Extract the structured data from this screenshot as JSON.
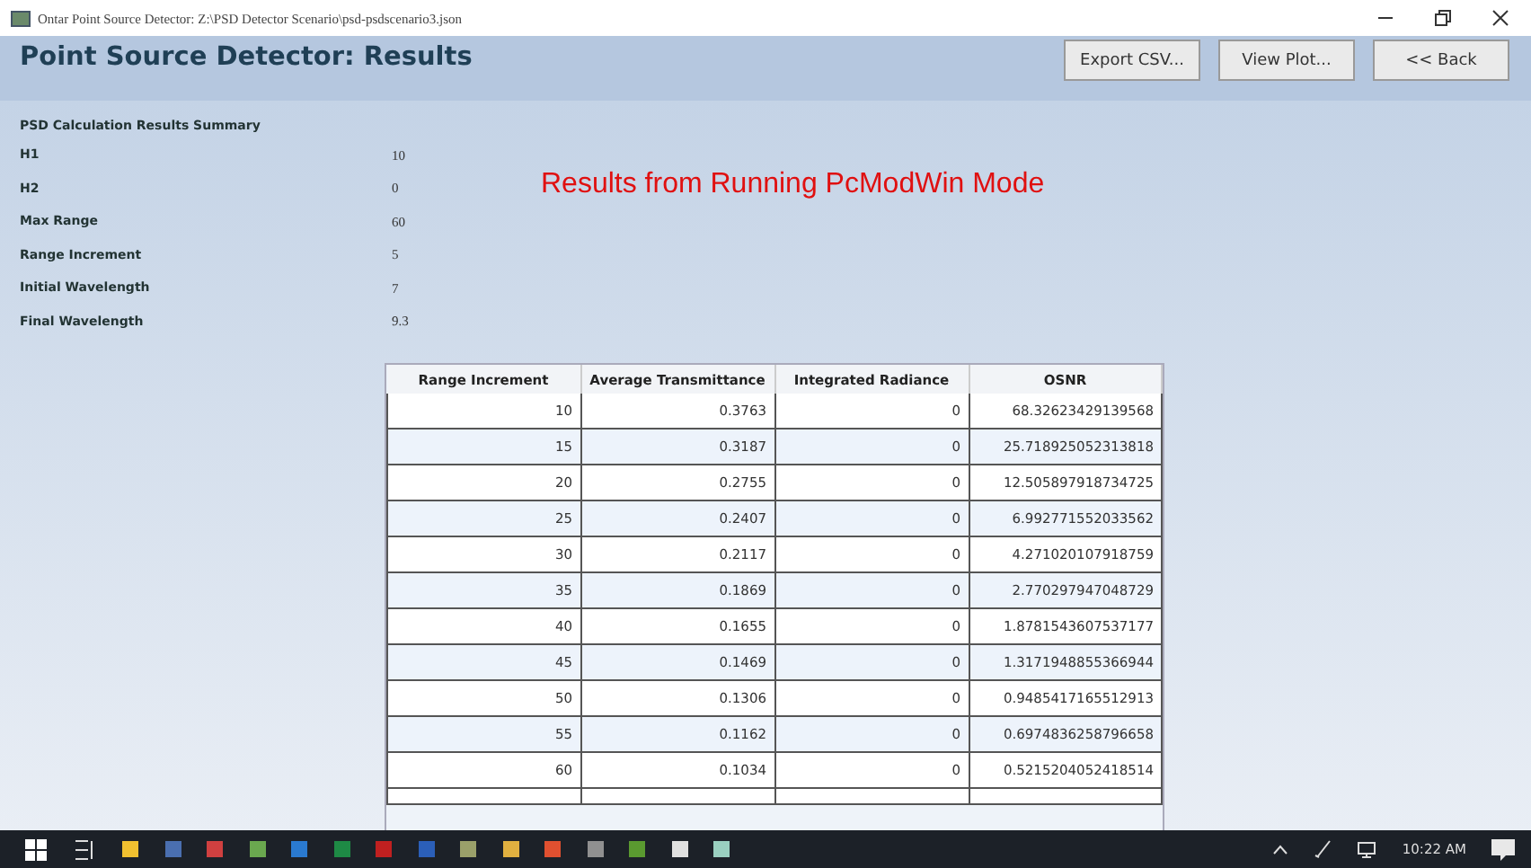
{
  "window": {
    "title": "Ontar Point Source Detector: Z:\\PSD Detector  Scenario\\psd-psdscenario3.json"
  },
  "header": {
    "title": "Point Source Detector: Results",
    "buttons": [
      "Export CSV...",
      "View Plot...",
      "<< Back"
    ]
  },
  "summary": {
    "heading": "PSD Calculation Results Summary",
    "items": [
      {
        "label": "H1",
        "value": "10"
      },
      {
        "label": "H2",
        "value": "0"
      },
      {
        "label": "Max Range",
        "value": "60"
      },
      {
        "label": "Range Increment",
        "value": "5"
      },
      {
        "label": "Initial Wavelength",
        "value": "7"
      },
      {
        "label": "Final Wavelength",
        "value": "9.3"
      }
    ]
  },
  "mode_message": "Results from Running PcModWin Mode",
  "table": {
    "columns": [
      "Range Increment",
      "Average Transmittance",
      "Integrated Radiance",
      "OSNR"
    ],
    "rows": [
      [
        "10",
        "0.3763",
        "0",
        "68.32623429139568"
      ],
      [
        "15",
        "0.3187",
        "0",
        "25.718925052313818"
      ],
      [
        "20",
        "0.2755",
        "0",
        "12.505897918734725"
      ],
      [
        "25",
        "0.2407",
        "0",
        "6.992771552033562"
      ],
      [
        "30",
        "0.2117",
        "0",
        "4.271020107918759"
      ],
      [
        "35",
        "0.1869",
        "0",
        "2.770297947048729"
      ],
      [
        "40",
        "0.1655",
        "0",
        "1.8781543607537177"
      ],
      [
        "45",
        "0.1469",
        "0",
        "1.3171948855366944"
      ],
      [
        "50",
        "0.1306",
        "0",
        "0.9485417165512913"
      ],
      [
        "55",
        "0.1162",
        "0",
        "0.6974836258796658"
      ],
      [
        "60",
        "0.1034",
        "0",
        "0.5215204052418514"
      ]
    ]
  },
  "taskbar": {
    "time": "10:22 AM"
  }
}
